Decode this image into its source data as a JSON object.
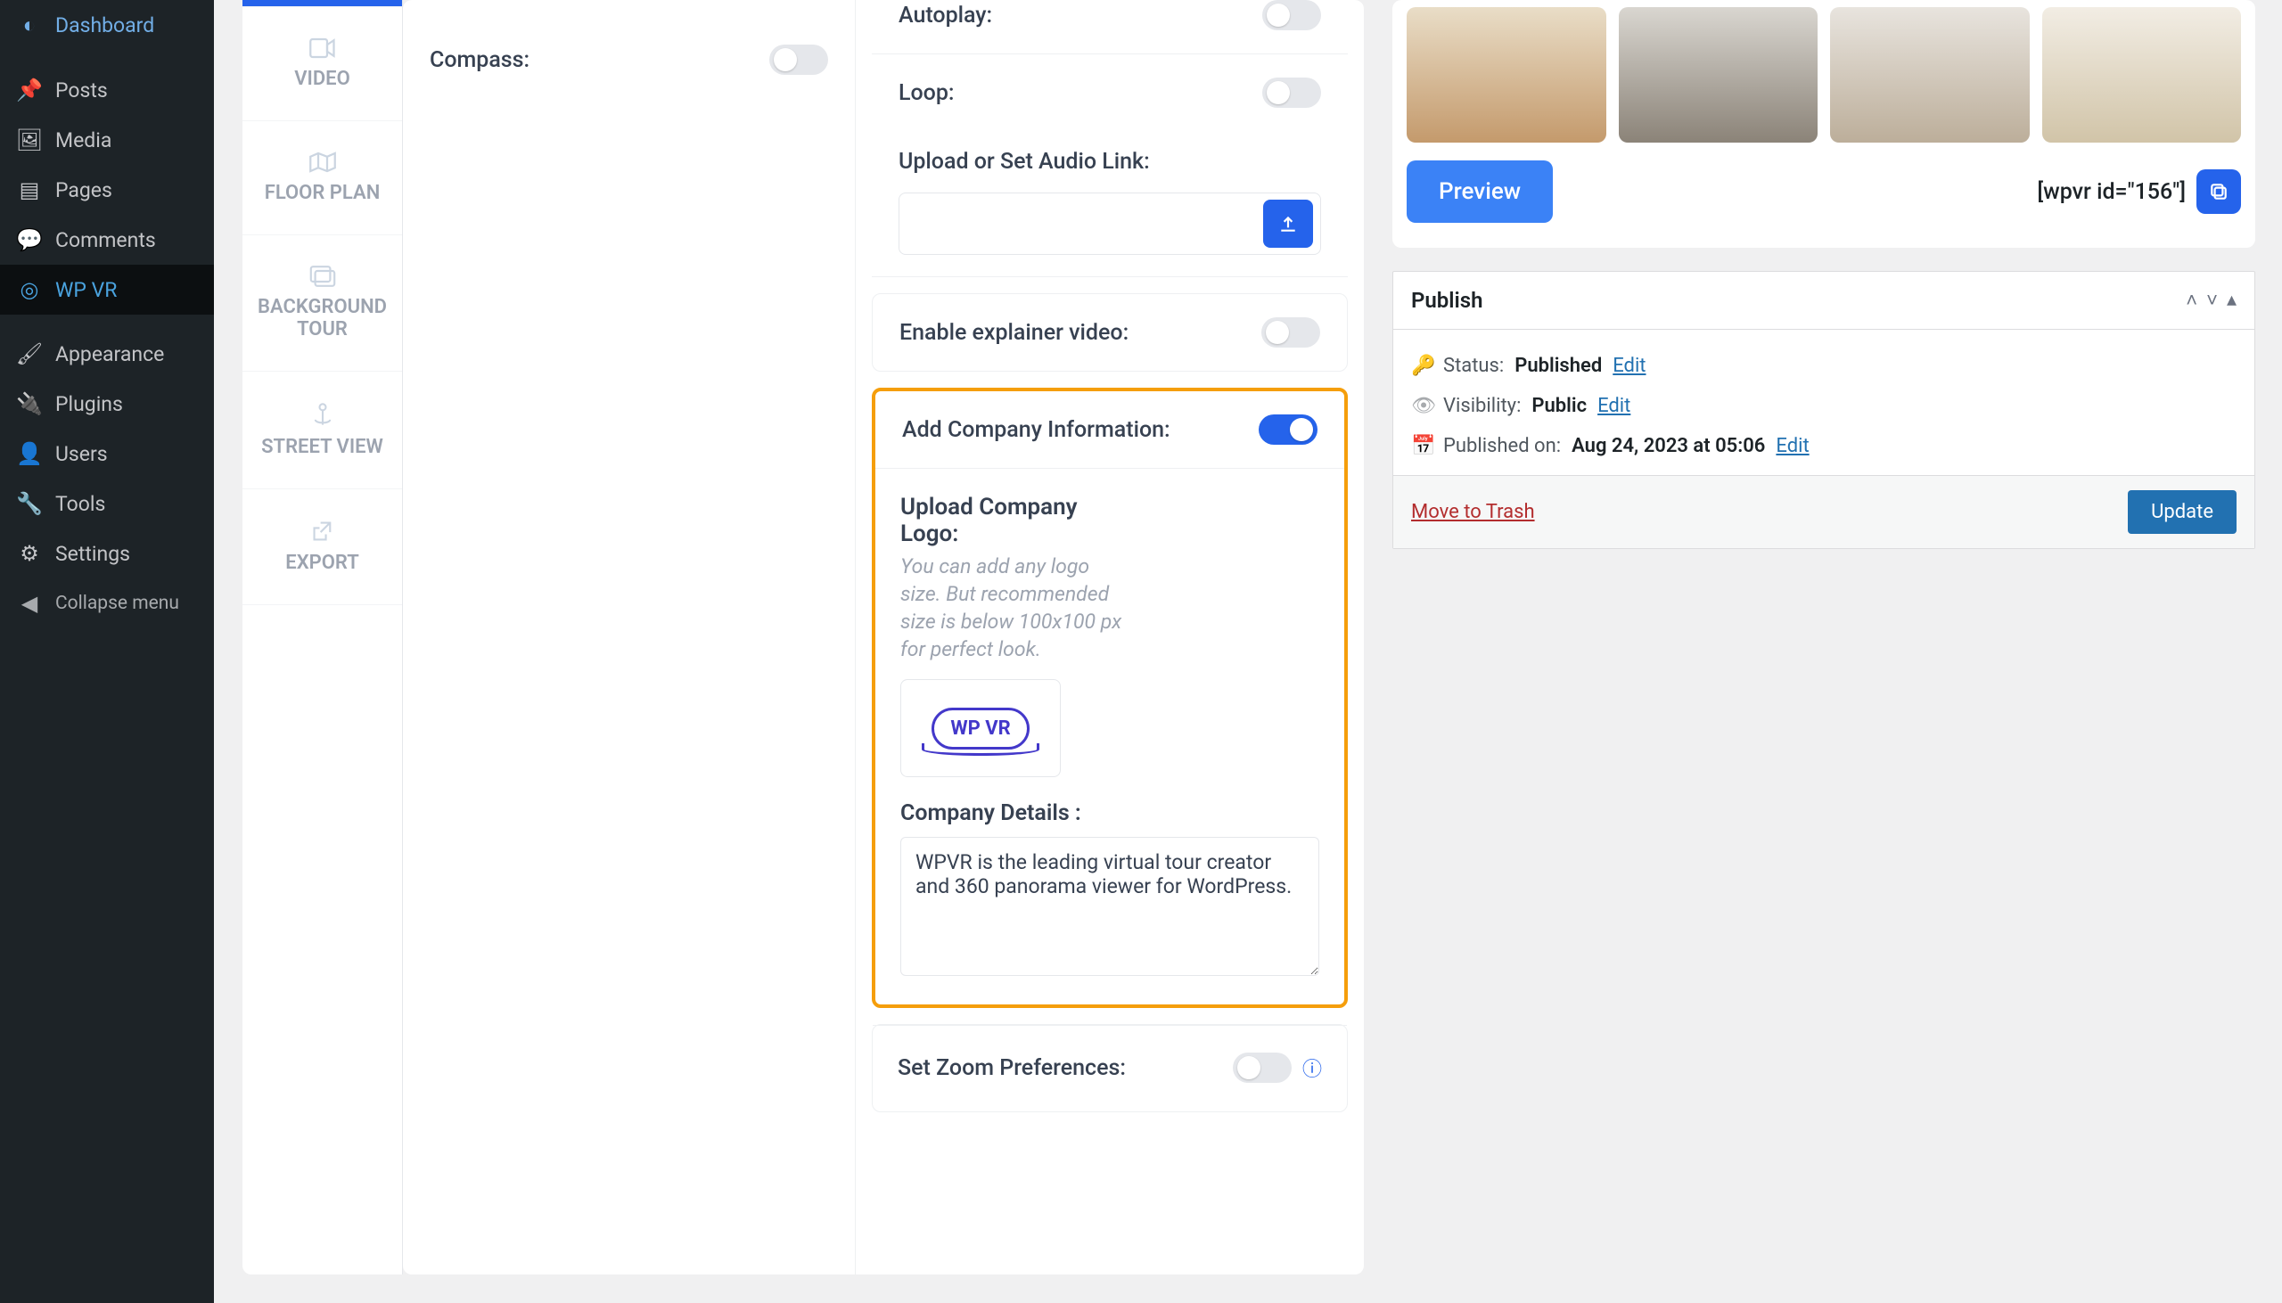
{
  "sidebar": {
    "items": [
      {
        "label": "Dashboard",
        "icon": "dashboard"
      },
      {
        "label": "Posts",
        "icon": "pin"
      },
      {
        "label": "Media",
        "icon": "media"
      },
      {
        "label": "Pages",
        "icon": "page"
      },
      {
        "label": "Comments",
        "icon": "comment"
      },
      {
        "label": "WP VR",
        "icon": "vr"
      },
      {
        "label": "Appearance",
        "icon": "brush"
      },
      {
        "label": "Plugins",
        "icon": "plug"
      },
      {
        "label": "Users",
        "icon": "user"
      },
      {
        "label": "Tools",
        "icon": "wrench"
      },
      {
        "label": "Settings",
        "icon": "settings"
      }
    ],
    "collapse": "Collapse menu"
  },
  "vtabs": [
    {
      "label": "VIDEO"
    },
    {
      "label": "FLOOR PLAN"
    },
    {
      "label": "BACKGROUND TOUR"
    },
    {
      "label": "STREET VIEW"
    },
    {
      "label": "EXPORT"
    }
  ],
  "settings": {
    "compass": "Compass:",
    "autoplay": "Autoplay:",
    "loop": "Loop:",
    "upload_audio": "Upload or Set Audio Link:",
    "explainer": "Enable explainer video:",
    "company": {
      "title": "Add Company Information:",
      "logo_label": "Upload Company Logo:",
      "logo_hint": "You can add any logo size. But recommended size is below 100x100 px for perfect look.",
      "logo_text": "WP VR",
      "details_label": "Company Details :",
      "details_value": "WPVR is the leading virtual tour creator and 360 panorama viewer for WordPress."
    },
    "zoom": "Set Zoom Preferences:"
  },
  "preview": {
    "button": "Preview",
    "shortcode": "[wpvr id=\"156\"]"
  },
  "publish": {
    "title": "Publish",
    "status_label": "Status: ",
    "status_value": "Published",
    "visibility_label": "Visibility: ",
    "visibility_value": "Public",
    "published_label": "Published on: ",
    "published_value": "Aug 24, 2023 at 05:06",
    "edit": "Edit",
    "trash": "Move to Trash",
    "update": "Update"
  }
}
